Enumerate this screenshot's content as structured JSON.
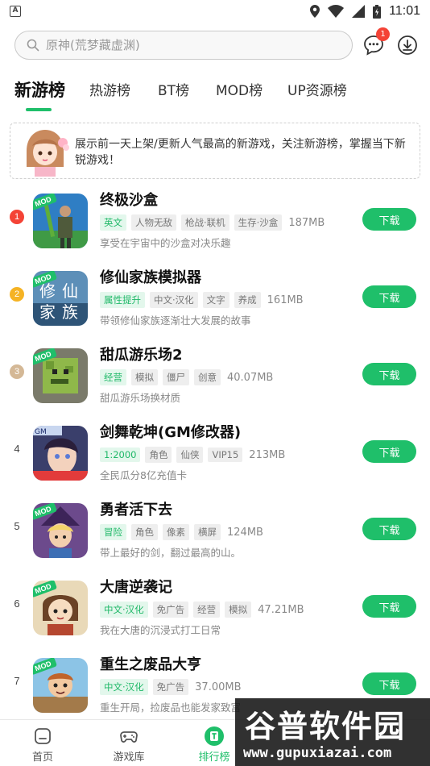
{
  "status_bar": {
    "time": "11:01",
    "left_icon": "A"
  },
  "search": {
    "placeholder": "原神(荒梦藏虚渊)"
  },
  "header": {
    "message_badge": "1"
  },
  "tabs": [
    {
      "label": "新游榜",
      "active": true
    },
    {
      "label": "热游榜"
    },
    {
      "label": "BT榜"
    },
    {
      "label": "MOD榜"
    },
    {
      "label": "UP资源榜"
    }
  ],
  "notice": {
    "text": "展示前一天上架/更新人气最高的新游戏，关注新游榜，掌握当下新锐游戏！"
  },
  "games": [
    {
      "rank": "1",
      "title": "终极沙盒",
      "tags": [
        "英文",
        "人物无敌",
        "枪战·联机",
        "生存·沙盒"
      ],
      "size": "187MB",
      "desc": "享受在宇宙中的沙盒对决乐趣",
      "button": "下载",
      "mod": "MOD"
    },
    {
      "rank": "2",
      "title": "修仙家族模拟器",
      "tags": [
        "属性提升",
        "中文·汉化",
        "文字",
        "养成"
      ],
      "size": "161MB",
      "desc": "带领修仙家族逐渐壮大发展的故事",
      "button": "下载",
      "mod": "MOD"
    },
    {
      "rank": "3",
      "title": "甜瓜游乐场2",
      "tags": [
        "经营",
        "模拟",
        "僵尸",
        "创意"
      ],
      "size": "40.07MB",
      "desc": "甜瓜游乐场换材质",
      "button": "下载",
      "mod": "MOD"
    },
    {
      "rank": "4",
      "title": "剑舞乾坤(GM修改器)",
      "tags": [
        "1:2000",
        "角色",
        "仙侠",
        "VIP15"
      ],
      "size": "213MB",
      "desc": "全民瓜分8亿充值卡",
      "button": "下载",
      "mod": ""
    },
    {
      "rank": "5",
      "title": "勇者活下去",
      "tags": [
        "冒险",
        "角色",
        "像素",
        "横屏"
      ],
      "size": "124MB",
      "desc": "带上最好的剑，翻过最高的山。",
      "button": "下载",
      "mod": "MOD"
    },
    {
      "rank": "6",
      "title": "大唐逆袭记",
      "tags": [
        "中文·汉化",
        "免广告",
        "经营",
        "模拟"
      ],
      "size": "47.21MB",
      "desc": "我在大唐的沉浸式打工日常",
      "button": "下载",
      "mod": "MOD"
    },
    {
      "rank": "7",
      "title": "重生之废品大亨",
      "tags": [
        "中文·汉化",
        "免广告"
      ],
      "size": "37.00MB",
      "desc": "重生开局，捡废品也能发家致富",
      "button": "下载",
      "mod": "MOD"
    }
  ],
  "bottom_nav": [
    {
      "label": "首页"
    },
    {
      "label": "游戏库"
    },
    {
      "label": "排行榜",
      "active": true
    },
    {
      "label": ""
    },
    {
      "label": ""
    }
  ],
  "watermark": {
    "title": "谷普软件园",
    "url": "www.gupuxiazai.com"
  },
  "colors": {
    "accent": "#1fbf6a",
    "rank1": "#f44336",
    "rank2": "#f5b324",
    "rank3": "#d4b896"
  }
}
